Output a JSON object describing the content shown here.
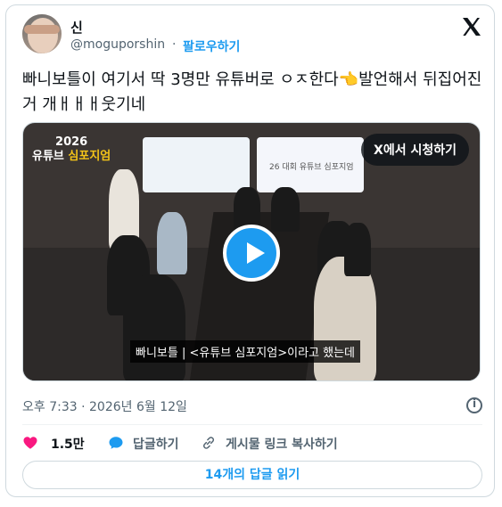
{
  "author": {
    "name": "신",
    "handle": "@moguporshin",
    "separator": "·",
    "follow_label": "팔로우하기"
  },
  "tweet": {
    "text": "빠니보틀이 여기서 딱 3명만 유튜버로 ㅇㅈ한다👈발언해서 뒤집어진거 개ㅐㅐㅐ웃기네"
  },
  "media": {
    "watch_label": "X에서 시청하기",
    "logo_year": "2026",
    "logo_title_prefix": "유튜브 ",
    "logo_title_highlight": "심포지엄",
    "screen_text": "26 대회 유튜브 심포지엄",
    "caption": "빠니보틀 | <유튜브 심포지엄>이라고 했는데"
  },
  "meta": {
    "timestamp": "오후 7:33 · 2026년 6월 12일"
  },
  "actions": {
    "likes": "1.5만",
    "reply_label": "답글하기",
    "copy_link_label": "게시물 링크 복사하기"
  },
  "read_replies_label": "14개의 답글 읽기",
  "colors": {
    "accent": "#1d9bf0",
    "like": "#f91880",
    "muted": "#536471",
    "border": "#cfd9de"
  }
}
